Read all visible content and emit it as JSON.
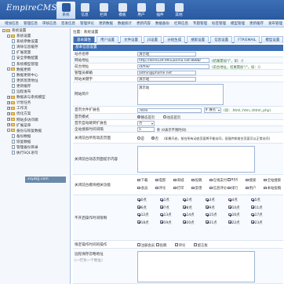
{
  "app": {
    "logo": "EmpireCMS"
  },
  "mainnav": [
    "系统",
    "信息",
    "栏目",
    "模板",
    "用户",
    "插件",
    "其他"
  ],
  "subnav": [
    "增加信息",
    "管理信息",
    "审核信息",
    "签发信息",
    "管理评论",
    "更新数据",
    "数据统计",
    "更新内容",
    "数据备份",
    "栏目信息",
    "专题管理",
    "标签管理",
    "模型管理",
    "更新缓存",
    "发布管理",
    "栏目管理"
  ],
  "sidebar": [
    {
      "label": "系统设置",
      "depth": 0,
      "pm": "-"
    },
    {
      "label": "系统设置",
      "depth": 1,
      "pm": "-"
    },
    {
      "label": "系统参数设置",
      "depth": 2
    },
    {
      "label": "清除信息缓存",
      "depth": 2
    },
    {
      "label": "扩展变量",
      "depth": 2
    },
    {
      "label": "安全参数配置",
      "depth": 2
    },
    {
      "label": "系统模型管理",
      "depth": 2
    },
    {
      "label": "数据更新",
      "depth": 1,
      "pm": "-"
    },
    {
      "label": "数据更新中心",
      "depth": 2
    },
    {
      "label": "更新反馈地址",
      "depth": 2
    },
    {
      "label": "更新缓存",
      "depth": 2
    },
    {
      "label": "远程发布",
      "depth": 2
    },
    {
      "label": "数据表与系统模型",
      "depth": 1,
      "pm": "+"
    },
    {
      "label": "计划任务",
      "depth": 1,
      "pm": "+"
    },
    {
      "label": "工作流",
      "depth": 1,
      "pm": "+"
    },
    {
      "label": "优化方案",
      "depth": 1,
      "pm": "+"
    },
    {
      "label": "网站多访问端",
      "depth": 1,
      "pm": "+"
    },
    {
      "label": "扩展菜单",
      "depth": 1,
      "pm": "+"
    },
    {
      "label": "备份与恢复数据",
      "depth": 1,
      "pm": "-"
    },
    {
      "label": "备份数据",
      "depth": 2
    },
    {
      "label": "恢复数据",
      "depth": 2
    },
    {
      "label": "管理备份目录",
      "depth": 2
    },
    {
      "label": "执行SQL语句",
      "depth": 2
    }
  ],
  "watermark": "xsyakjj.com",
  "content": {
    "crumb": "位置：系统设置",
    "tabs": [
      "基本属性",
      "用户设置",
      "文件设置",
      "JS设置",
      "分组生成",
      "搜索设置",
      "信息设置",
      "FTP/EMAIL",
      "模型设置",
      "图片设置"
    ],
    "section": "基本信息设置",
    "site_name": {
      "label": "站点名称",
      "value": "演示站"
    },
    "site_url": {
      "label": "网站地址",
      "value": "http://demo39.99vuanma.net:8888/",
      "hint": "(结尾需加\"/\"，如：/)"
    },
    "site_dir": {
      "label": "前台地址",
      "value": "/d/file/",
      "hint": "(前台地址，结尾需加\"/\"，如：/)"
    },
    "admin_email": {
      "label": "管理员邮箱",
      "value": "admin@phome.net"
    },
    "keywords": {
      "label": "网站关键字",
      "value": "演示站"
    },
    "description": {
      "label": "网站简介",
      "value": "演示站"
    },
    "index_ext": {
      "label": "首页文件扩展名",
      "value": ".html",
      "select": "扩展名",
      "hint": "(如：.html,.htm,.shtml,.php)"
    },
    "index_mode": {
      "label": "首页模式",
      "opt1": "静态首页",
      "opt2": "动态首页"
    },
    "index_ext2": {
      "label": "首页自动跳转扩展名",
      "value": "否"
    },
    "search_time": {
      "label": "全站搜索时间间隔",
      "value": "5",
      "hint": "秒 (0表示不限时间)"
    },
    "close_site": {
      "label": "关闭前台所有动态页面",
      "opt1": "是",
      "opt2": "否",
      "hint": "(如果开启，前台所有动态页面将不能访问，但插件和前台页面可以正常访问)"
    },
    "close_prompt": {
      "label": "关闭前台动态页面提示内容",
      "value": ""
    },
    "close_modules": {
      "label": "关闭前台模块相关功能",
      "opts": [
        "下载",
        "电影",
        "商城",
        "投稿",
        "在线支付",
        "RSS",
        "搜索",
        "全站搜索",
        "会员",
        "评论",
        "打印",
        "反馈",
        "信息评分",
        "排行",
        "用户",
        "本站投稿"
      ]
    },
    "not_refresh": {
      "label": "不开启操作时间限制",
      "opts": [
        "0点",
        "1点",
        "2点",
        "3点",
        "4点",
        "5点",
        "6点",
        "7点",
        "8点",
        "9点",
        "10点",
        "11点",
        "12点",
        "13点",
        "14点",
        "15点",
        "16点",
        "17点",
        "18点",
        "19点",
        "20点",
        "21点",
        "22点",
        "23点"
      ],
      "checked": [
        0,
        1,
        2,
        3,
        4,
        5,
        6,
        7,
        8,
        9,
        10,
        11,
        12,
        13,
        14,
        15,
        16,
        17,
        18,
        19,
        20,
        21,
        22,
        23
      ]
    },
    "restrict_ops": {
      "label": "限定操作时间的操作",
      "opts": [
        "注册会员",
        "投稿",
        "评论",
        "留言板"
      ]
    },
    "filter_ip": {
      "label": "远程保存忽略地址",
      "hint": "(一行为一个地址)"
    }
  }
}
